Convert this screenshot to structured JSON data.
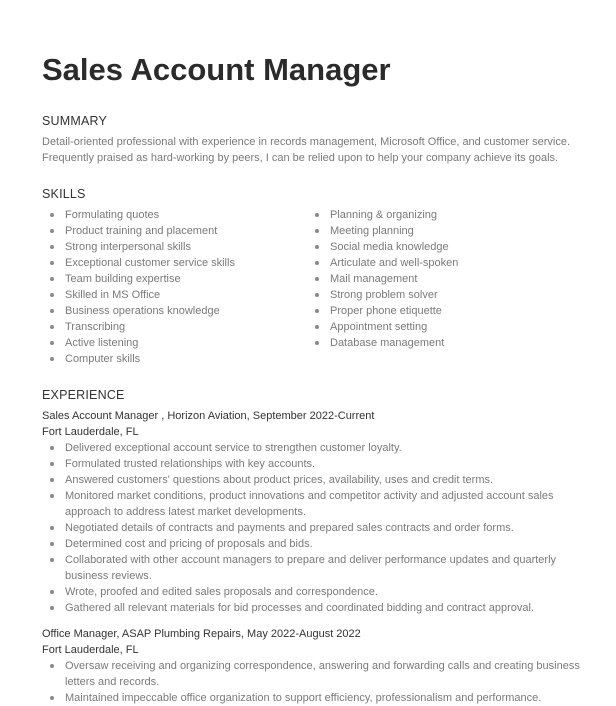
{
  "resume": {
    "title": "Sales Account Manager",
    "summary": {
      "heading": "SUMMARY",
      "text": "Detail-oriented professional with experience in records management, Microsoft Office, and customer service. Frequently praised as hard-working by peers, I can be relied upon to help your company achieve its goals."
    },
    "skills": {
      "heading": "SKILLS",
      "left": [
        "Formulating quotes",
        "Product training and placement",
        "Strong interpersonal skills",
        "Exceptional customer service skills",
        "Team building expertise",
        "Skilled in MS Office",
        "Business operations knowledge",
        "Transcribing",
        "Active listening",
        "Computer skills"
      ],
      "right": [
        "Planning & organizing",
        "Meeting planning",
        "Social media knowledge",
        "Articulate and well-spoken",
        "Mail management",
        "Strong problem solver",
        "Proper phone etiquette",
        "Appointment setting",
        "Database management"
      ]
    },
    "experience": {
      "heading": "EXPERIENCE",
      "jobs": [
        {
          "title_line": "Sales Account Manager , Horizon Aviation, September 2022-Current",
          "location": "Fort Lauderdale, FL",
          "bullets": [
            "Delivered exceptional account service to strengthen customer loyalty.",
            "Formulated trusted relationships with key accounts.",
            "Answered customers' questions about product prices, availability, uses and credit terms.",
            "Monitored market conditions, product innovations and competitor activity and adjusted account sales approach to address latest market developments.",
            "Negotiated details of contracts and payments and prepared sales contracts and order forms.",
            "Determined cost and pricing of proposals and bids.",
            "Collaborated with other account managers to prepare and deliver performance updates and quarterly business reviews.",
            "Wrote, proofed and edited sales proposals and correspondence.",
            "Gathered all relevant materials for bid processes and coordinated bidding and contract approval."
          ]
        },
        {
          "title_line": "Office Manager, ASAP Plumbing Repairs, May 2022-August 2022",
          "location": "Fort Lauderdale, FL",
          "bullets": [
            "Oversaw receiving and organizing correspondence, answering and forwarding calls and creating business letters and records.",
            "Maintained impeccable office organization to support efficiency, professionalism and performance."
          ]
        }
      ]
    }
  }
}
